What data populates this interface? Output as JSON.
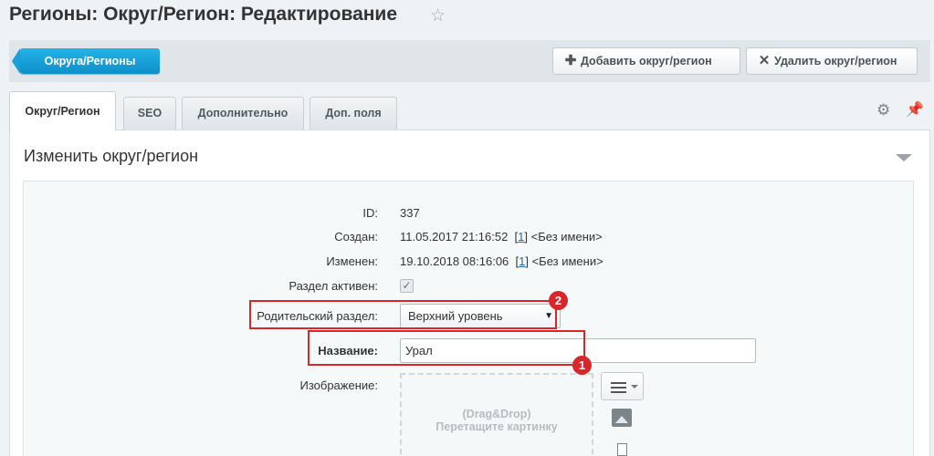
{
  "header": {
    "title": "Регионы: Округ/Регион: Редактирование"
  },
  "toolbar": {
    "back_label": "Округа/Регионы",
    "add_label": "Добавить округ/регион",
    "delete_label": "Удалить округ/регион"
  },
  "tabs": [
    {
      "label": "Округ/Регион",
      "active": true
    },
    {
      "label": "SEO",
      "active": false
    },
    {
      "label": "Дополнительно",
      "active": false
    },
    {
      "label": "Доп. поля",
      "active": false
    }
  ],
  "panel": {
    "title": "Изменить округ/регион"
  },
  "form": {
    "id_label": "ID:",
    "id_value": "337",
    "created_label": "Создан:",
    "created_date": "11.05.2017 21:16:52",
    "created_user_link": "1",
    "created_user_name": "<Без имени>",
    "modified_label": "Изменен:",
    "modified_date": "19.10.2018 08:16:06",
    "modified_user_link": "1",
    "modified_user_name": "<Без имени>",
    "active_label": "Раздел активен:",
    "active_checked": true,
    "parent_label": "Родительский раздел:",
    "parent_value": "Верхний уровень",
    "name_label": "Название:",
    "name_value": "Урал",
    "image_label": "Изображение:",
    "dropzone_line1": "(Drag&Drop)",
    "dropzone_line2": "Перетащите картинку"
  },
  "annotations": {
    "badge_1": "1",
    "badge_2": "2",
    "color": "#d9262b"
  },
  "colors": {
    "accent": "#1ba3dc",
    "background": "#eef2f4"
  }
}
